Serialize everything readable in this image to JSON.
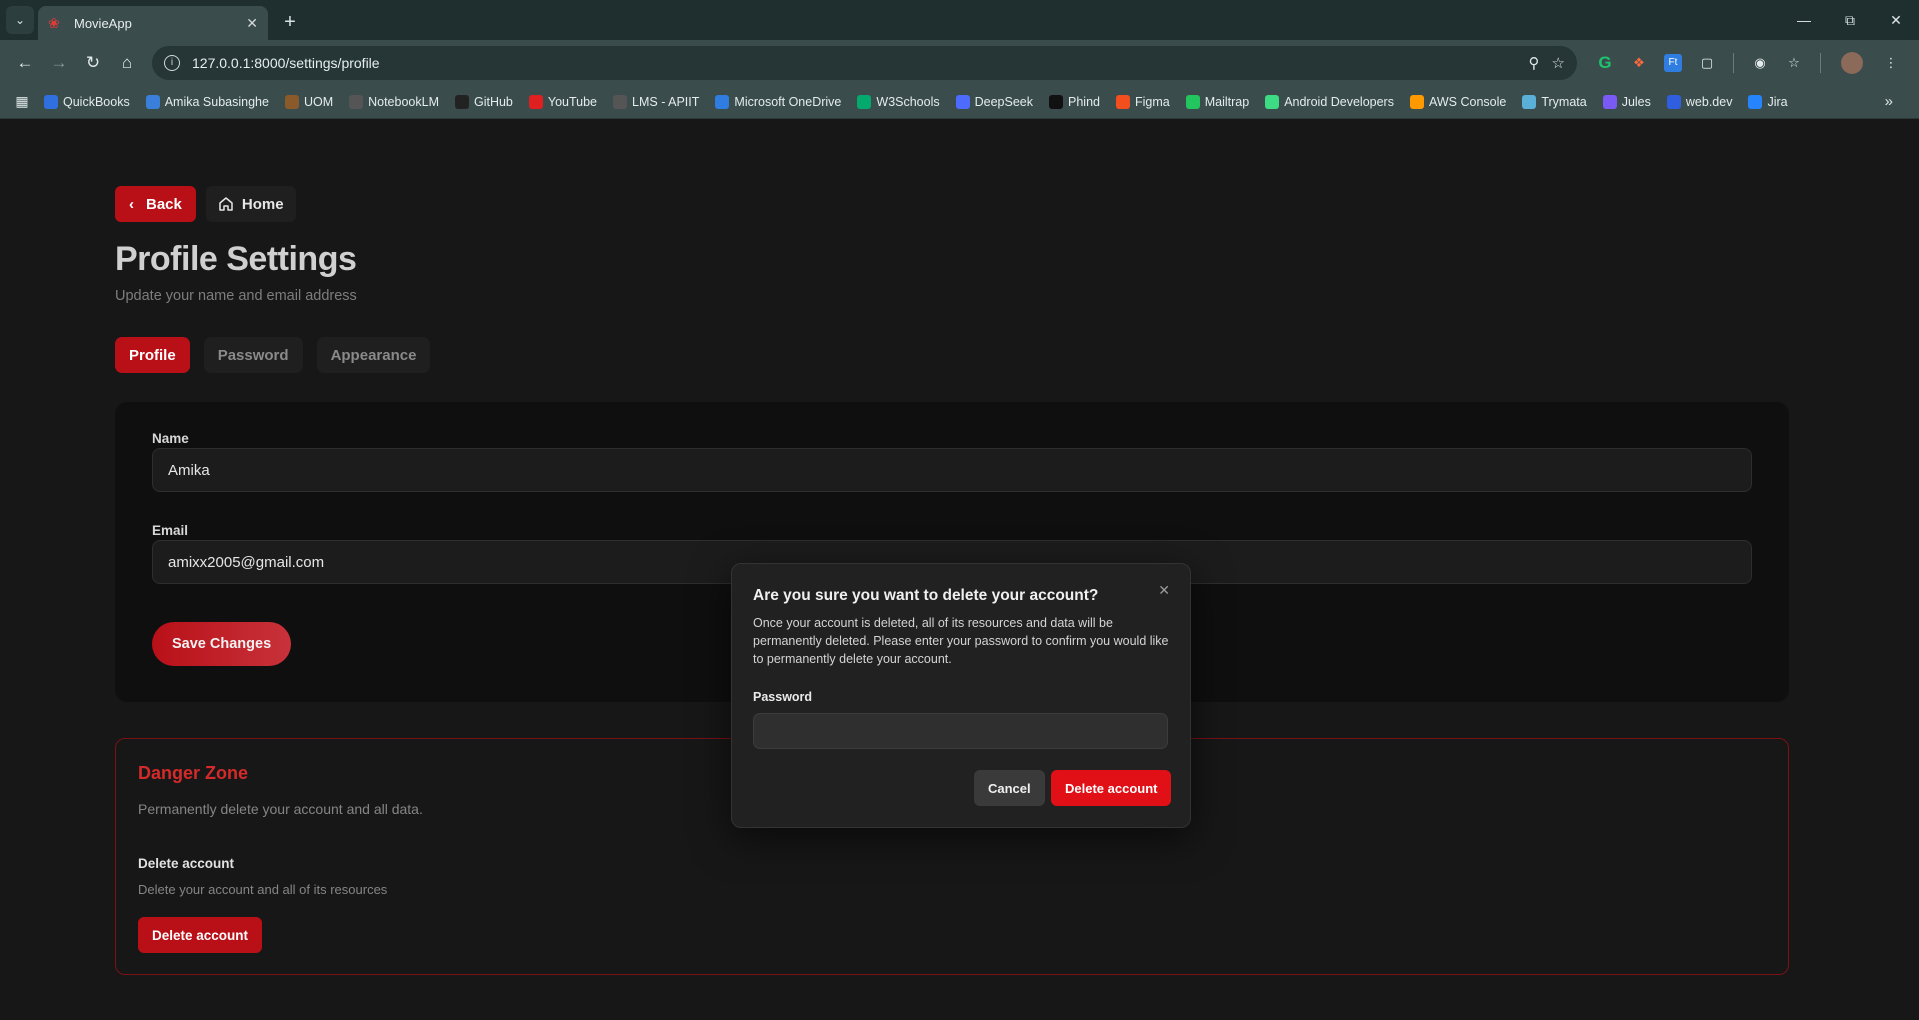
{
  "browser": {
    "tab_title": "MovieApp",
    "url": "127.0.0.1:8000/settings/profile",
    "bookmarks": [
      {
        "label": "QuickBooks",
        "color": "#2f6fe0"
      },
      {
        "label": "Amika Subasinghe",
        "color": "#3a7fd9"
      },
      {
        "label": "UOM",
        "color": "#8a5a2a"
      },
      {
        "label": "NotebookLM",
        "color": "#555555"
      },
      {
        "label": "GitHub",
        "color": "#222222"
      },
      {
        "label": "YouTube",
        "color": "#e02020"
      },
      {
        "label": "LMS - APIIT",
        "color": "#555555"
      },
      {
        "label": "Microsoft OneDrive",
        "color": "#2f7de0"
      },
      {
        "label": "W3Schools",
        "color": "#04aa6d"
      },
      {
        "label": "DeepSeek",
        "color": "#4d6bfe"
      },
      {
        "label": "Phind",
        "color": "#111111"
      },
      {
        "label": "Figma",
        "color": "#f24e1e"
      },
      {
        "label": "Mailtrap",
        "color": "#22c55e"
      },
      {
        "label": "Android Developers",
        "color": "#3ddc84"
      },
      {
        "label": "AWS Console",
        "color": "#ff9900"
      },
      {
        "label": "Trymata",
        "color": "#5ab0d6"
      },
      {
        "label": "Jules",
        "color": "#7a5af5"
      },
      {
        "label": "web.dev",
        "color": "#2f5fe0"
      },
      {
        "label": "Jira",
        "color": "#2684ff"
      }
    ]
  },
  "page": {
    "back_label": "Back",
    "home_label": "Home",
    "title": "Profile Settings",
    "subtitle": "Update your name and email address",
    "tabs": [
      {
        "label": "Profile",
        "active": true
      },
      {
        "label": "Password",
        "active": false
      },
      {
        "label": "Appearance",
        "active": false
      }
    ],
    "form": {
      "name_label": "Name",
      "name_value": "Amika",
      "email_label": "Email",
      "email_value": "amixx2005@gmail.com",
      "save_label": "Save Changes"
    },
    "danger": {
      "title": "Danger Zone",
      "subtitle": "Permanently delete your account and all data.",
      "section_title": "Delete account",
      "section_sub": "Delete your account and all of its resources",
      "button_label": "Delete account"
    }
  },
  "modal": {
    "title": "Are you sure you want to delete your account?",
    "description": "Once your account is deleted, all of its resources and data will be permanently deleted. Please enter your password to confirm you would like to permanently delete your account.",
    "password_label": "Password",
    "password_value": "",
    "cancel_label": "Cancel",
    "delete_label": "Delete account"
  },
  "colors": {
    "accent": "#b91018",
    "modal_delete": "#e10f16",
    "danger_text": "#d42a2a"
  }
}
